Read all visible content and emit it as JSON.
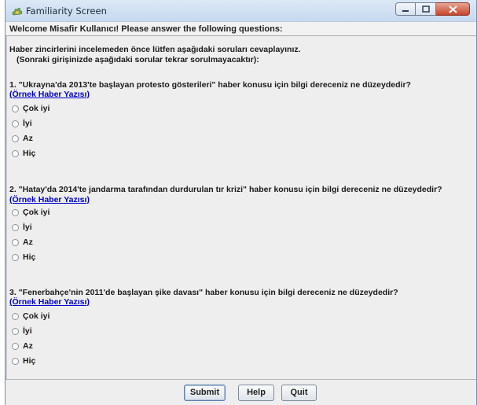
{
  "window": {
    "title": "Familiarity Screen"
  },
  "header": {
    "welcome": "Welcome Misafir Kullanıcı! Please answer the following questions:"
  },
  "intro": {
    "line1": "Haber zincirlerini incelemeden önce lütfen aşağıdaki soruları cevaplayınız.",
    "line2": "(Sonraki girişinizde aşağıdaki sorular tekrar sorulmayacaktır):"
  },
  "questions": [
    {
      "text": "1. \"Ukrayna'da 2013'te başlayan protesto gösterileri\" haber konusu için bilgi dereceniz ne düzeydedir?",
      "link": "(Örnek Haber Yazısı)",
      "options": [
        "Çok iyi",
        "İyi",
        "Az",
        "Hiç"
      ]
    },
    {
      "text": "2. \"Hatay'da 2014'te jandarma tarafından durdurulan tır krizi\" haber konusu için bilgi dereceniz ne düzeydedir?",
      "link": "(Örnek Haber Yazısı)",
      "options": [
        "Çok iyi",
        "İyi",
        "Az",
        "Hiç"
      ]
    },
    {
      "text": "3. \"Fenerbahçe'nin 2011'de başlayan şike davası\" haber konusu için bilgi dereceniz ne düzeydedir?",
      "link": "(Örnek Haber Yazısı)",
      "options": [
        "Çok iyi",
        "İyi",
        "Az",
        "Hiç"
      ]
    }
  ],
  "buttons": {
    "submit": "Submit",
    "help": "Help",
    "quit": "Quit"
  }
}
